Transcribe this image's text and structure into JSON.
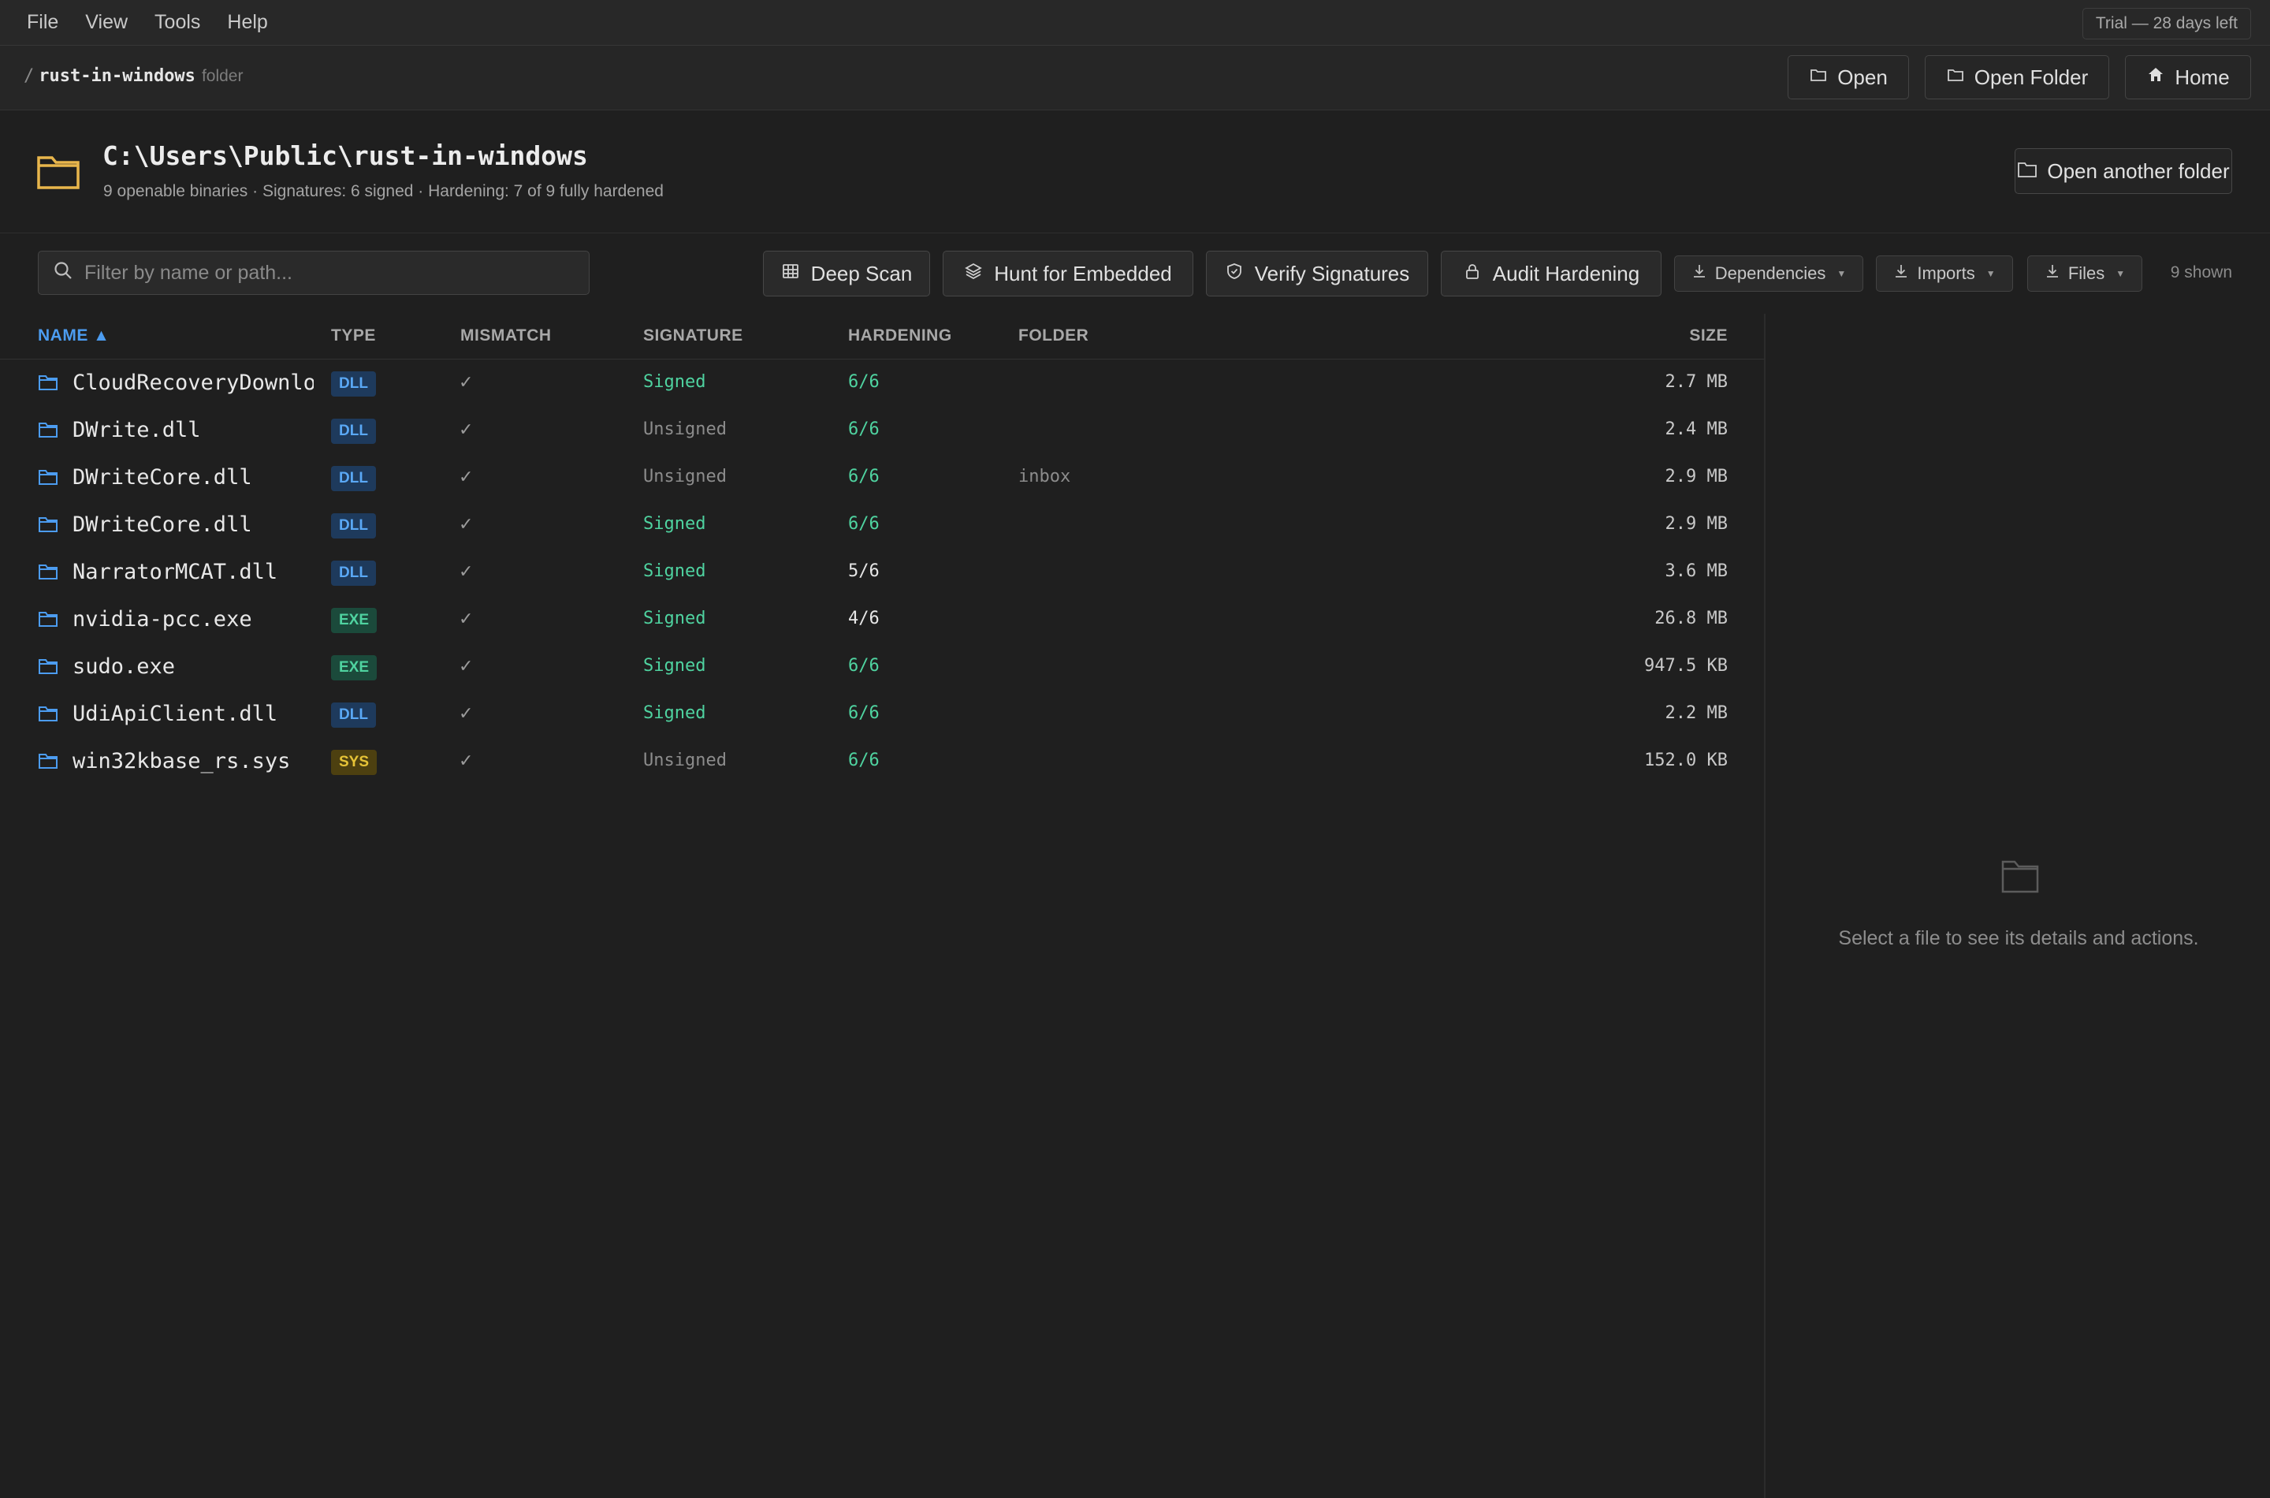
{
  "menu": [
    "File",
    "View",
    "Tools",
    "Help"
  ],
  "trial": "Trial — 28 days left",
  "breadcrumb": {
    "slash": "/",
    "current": "rust-in-windows",
    "kind": "folder"
  },
  "toolbar": {
    "open": "Open",
    "open_folder": "Open Folder",
    "home": "Home"
  },
  "header": {
    "path": "C:\\Users\\Public\\rust-in-windows",
    "summary": "9 openable binaries · Signatures: 6 signed · Hardening: 7 of 9 fully hardened",
    "open_another": "Open another folder"
  },
  "search": {
    "placeholder": "Filter by name or path..."
  },
  "actions": {
    "deep_scan": "Deep Scan",
    "hunt": "Hunt for Embedded",
    "verify": "Verify Signatures",
    "audit": "Audit Hardening",
    "dependencies": "Dependencies",
    "imports": "Imports",
    "files": "Files",
    "shown": "9 shown"
  },
  "columns": {
    "name": "NAME ▲",
    "type": "TYPE",
    "mismatch": "MISMATCH",
    "signature": "SIGNATURE",
    "hardening": "HARDENING",
    "folder": "FOLDER",
    "size": "SIZE"
  },
  "rows": [
    {
      "name": "CloudRecoveryDownloa",
      "type": "DLL",
      "mismatch": "✓",
      "signature": "Signed",
      "hardening": "6/6",
      "folder": "",
      "size": "2.7 MB"
    },
    {
      "name": "DWrite.dll",
      "type": "DLL",
      "mismatch": "✓",
      "signature": "Unsigned",
      "hardening": "6/6",
      "folder": "",
      "size": "2.4 MB"
    },
    {
      "name": "DWriteCore.dll",
      "type": "DLL",
      "mismatch": "✓",
      "signature": "Unsigned",
      "hardening": "6/6",
      "folder": "inbox",
      "size": "2.9 MB"
    },
    {
      "name": "DWriteCore.dll",
      "type": "DLL",
      "mismatch": "✓",
      "signature": "Signed",
      "hardening": "6/6",
      "folder": "",
      "size": "2.9 MB"
    },
    {
      "name": "NarratorMCAT.dll",
      "type": "DLL",
      "mismatch": "✓",
      "signature": "Signed",
      "hardening": "5/6",
      "folder": "",
      "size": "3.6 MB"
    },
    {
      "name": "nvidia-pcc.exe",
      "type": "EXE",
      "mismatch": "✓",
      "signature": "Signed",
      "hardening": "4/6",
      "folder": "",
      "size": "26.8 MB"
    },
    {
      "name": "sudo.exe",
      "type": "EXE",
      "mismatch": "✓",
      "signature": "Signed",
      "hardening": "6/6",
      "folder": "",
      "size": "947.5 KB"
    },
    {
      "name": "UdiApiClient.dll",
      "type": "DLL",
      "mismatch": "✓",
      "signature": "Signed",
      "hardening": "6/6",
      "folder": "",
      "size": "2.2 MB"
    },
    {
      "name": "win32kbase_rs.sys",
      "type": "SYS",
      "mismatch": "✓",
      "signature": "Unsigned",
      "hardening": "6/6",
      "folder": "",
      "size": "152.0 KB"
    }
  ],
  "details": {
    "empty": "Select a file to see its details and actions."
  },
  "colors": {
    "accent": "#4c9cf0",
    "signed": "#4fd3a0",
    "folder": "#e8b64c"
  }
}
